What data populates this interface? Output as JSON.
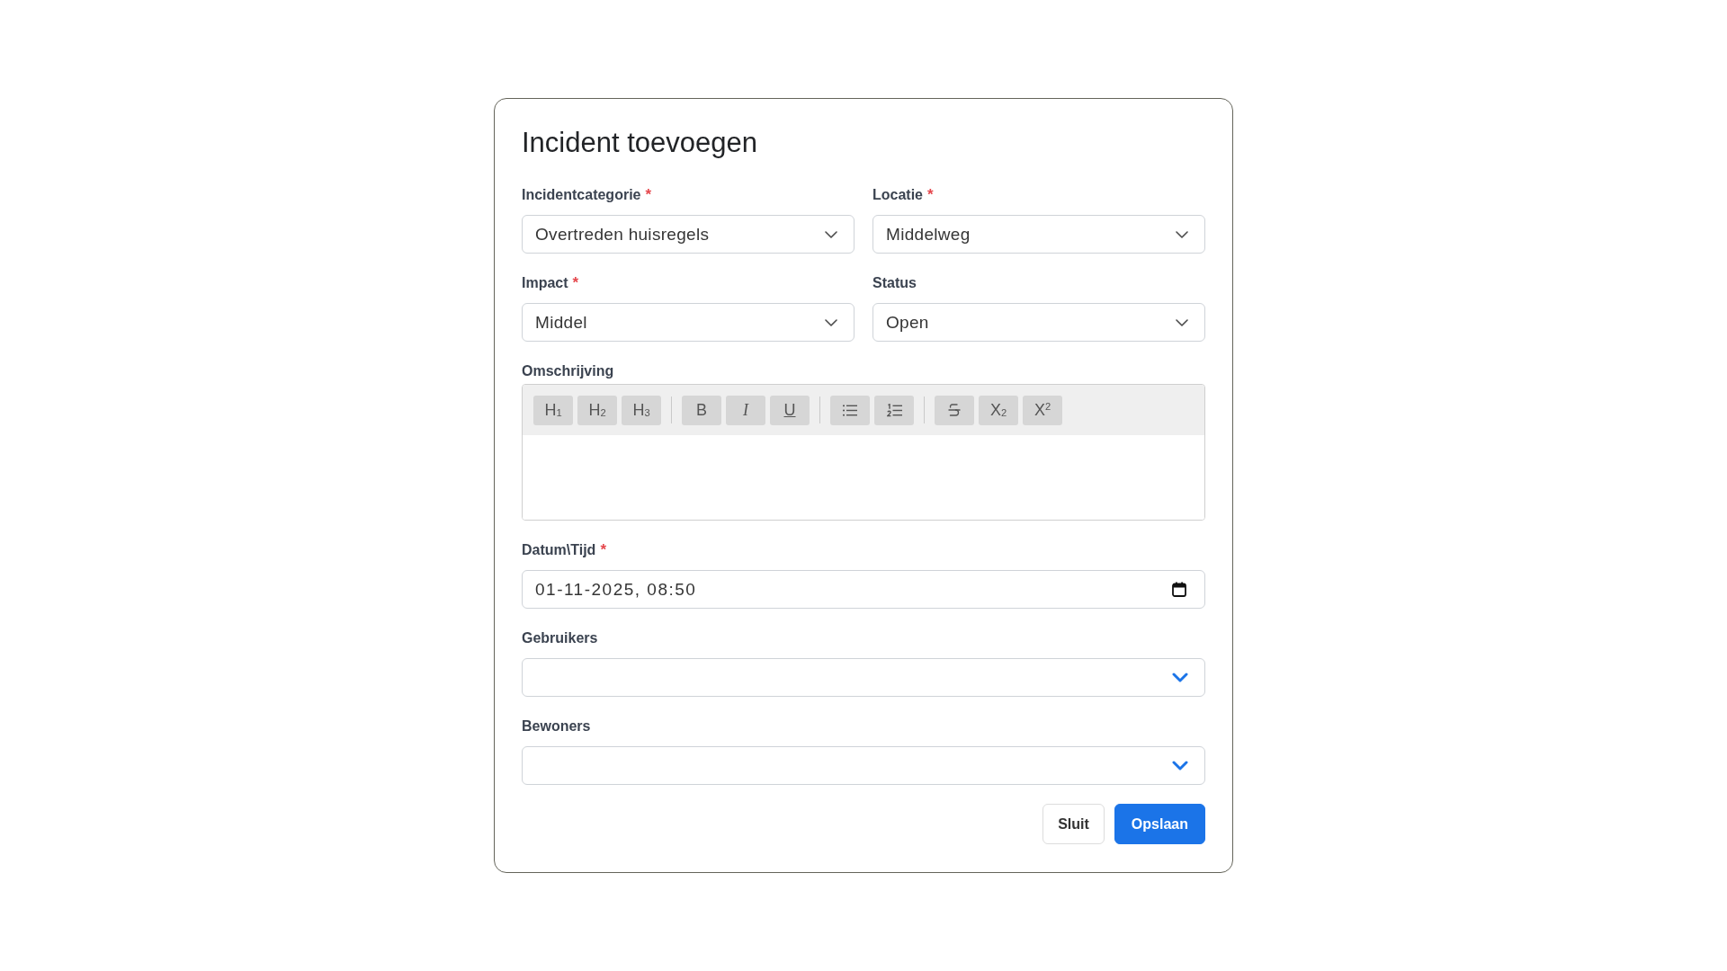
{
  "dialog": {
    "title": "Incident toevoegen",
    "fields": [
      {
        "kind": "select",
        "label": "Incidentcategorie",
        "required_mark": "*",
        "value": "Overtreden huisregels"
      },
      {
        "kind": "select",
        "label": "Locatie",
        "required_mark": "*",
        "value": "Middelweg"
      },
      {
        "kind": "select",
        "label": "Impact",
        "required_mark": "*",
        "value": "Middel"
      },
      {
        "kind": "select",
        "label": "Status",
        "value": "Open"
      },
      {
        "kind": "editor",
        "label": "Omschrijving",
        "toolbar": [
          {
            "buttons": [
              {
                "kind": "heading",
                "label": "H$_{1}$"
              },
              {
                "kind": "heading",
                "label": "H$_{2}$"
              },
              {
                "kind": "heading",
                "label": "H$_{3}$"
              }
            ]
          },
          {
            "buttons": [
              {
                "kind": "bold",
                "label": "B"
              },
              {
                "kind": "italic",
                "label": "I"
              },
              {
                "kind": "underline",
                "label": "U"
              }
            ]
          },
          {
            "buttons": [
              {
                "kind": "bullet_list"
              },
              {
                "kind": "numbered_list"
              }
            ]
          },
          {
            "buttons": [
              {
                "kind": "strike"
              },
              {
                "kind": "subscript",
                "label": "X$_{2}$"
              },
              {
                "kind": "superscript",
                "label": "X$^{2}$"
              }
            ]
          }
        ]
      },
      {
        "kind": "datetime",
        "label": "Datum\\Tijd",
        "required_mark": "*",
        "value": "01-11-2025, 08:50"
      },
      {
        "kind": "multiselect",
        "label": "Gebruikers"
      },
      {
        "kind": "multiselect",
        "label": "Bewoners"
      }
    ],
    "buttons": [
      {
        "kind": "secondary",
        "label": "Sluit"
      },
      {
        "kind": "primary",
        "label": "Opslaan"
      }
    ]
  }
}
